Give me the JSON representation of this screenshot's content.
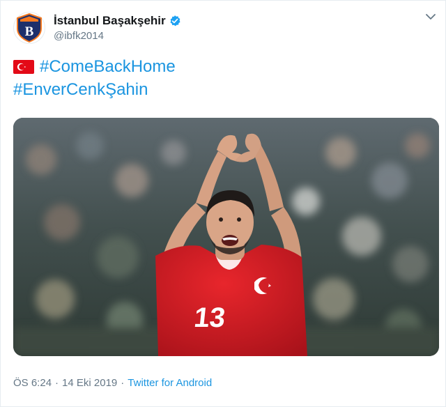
{
  "tweet": {
    "author": {
      "display_name": "İstanbul Başakşehir",
      "handle": "@ibfk2014",
      "verified": true,
      "avatar_icon": "club-crest-icon"
    },
    "menu_icon": "chevron-down-icon",
    "flag_icon": "turkey-flag-icon",
    "hashtags": [
      "#ComeBackHome",
      "#EnverCenkŞahin"
    ],
    "media": {
      "jersey_number": "13",
      "avatar_letter": "B"
    },
    "footer": {
      "time": "ÖS 6:24",
      "separator1": "·",
      "date": "14 Eki 2019",
      "separator2": "·",
      "source": "Twitter for Android"
    }
  },
  "colors": {
    "link": "#1b95e0",
    "secondary_text": "#657786",
    "primary_text": "#14171a",
    "jersey_red": "#d81e25",
    "crest_blue": "#1d2f6b",
    "crest_orange": "#f47920"
  }
}
